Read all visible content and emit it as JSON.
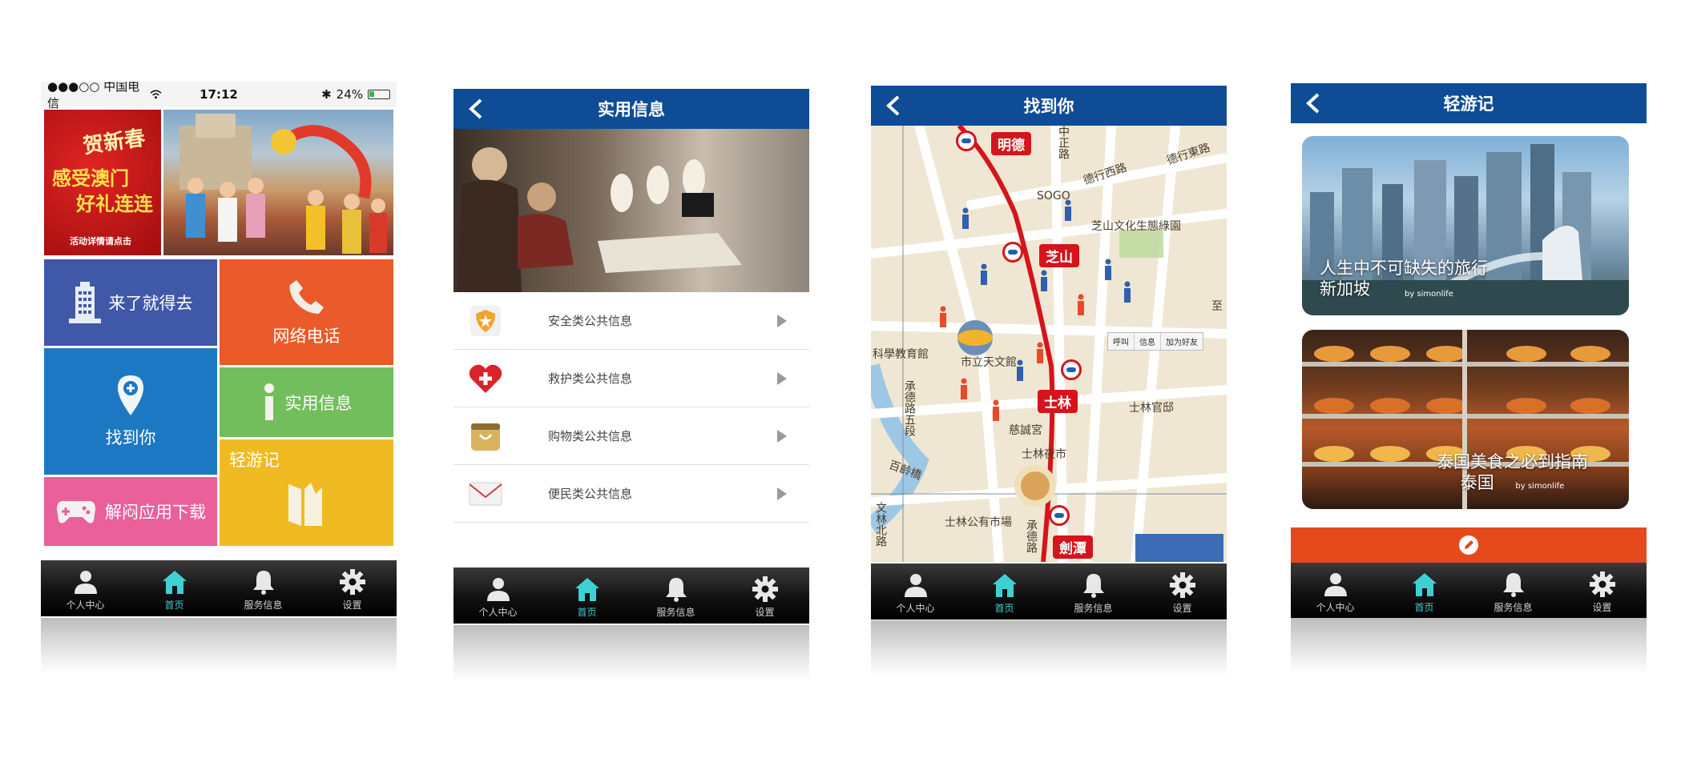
{
  "tabbar": {
    "items": [
      {
        "label": "个人中心",
        "icon": "person-icon"
      },
      {
        "label": "首页",
        "icon": "home-icon"
      },
      {
        "label": "服务信息",
        "icon": "bell-icon"
      },
      {
        "label": "设置",
        "icon": "gear-icon"
      }
    ],
    "active_index": 1,
    "active_color": "#3fd0d4"
  },
  "screen1": {
    "status": {
      "carrier": "●●●○○ 中国电信",
      "time": "17:12",
      "battery": "24%"
    },
    "banner": {
      "promo_line1": "贺新春",
      "promo_line2": "感受澳门",
      "promo_line3": "好礼连连",
      "promo_note": "活动详情请点击"
    },
    "tiles": [
      {
        "label": "来了就得去",
        "icon": "building-icon",
        "color": "#3f58a8"
      },
      {
        "label": "网络电话",
        "icon": "phone-icon",
        "color": "#ea5a2b"
      },
      {
        "label": "找到你",
        "icon": "location-pin-icon",
        "color": "#1d78c3"
      },
      {
        "label": "实用信息",
        "icon": "info-icon",
        "color": "#72be5c"
      },
      {
        "label": "轻游记",
        "icon": "book-icon",
        "color": "#f0bb22"
      },
      {
        "label": "解闷应用下载",
        "icon": "gamepad-icon",
        "color": "#e9609a"
      }
    ]
  },
  "screen2": {
    "title": "实用信息",
    "items": [
      {
        "label": "安全类公共信息",
        "icon": "shield-icon"
      },
      {
        "label": "救护类公共信息",
        "icon": "medical-heart-icon"
      },
      {
        "label": "购物类公共信息",
        "icon": "shopping-bag-icon"
      },
      {
        "label": "便民类公共信息",
        "icon": "envelope-icon"
      }
    ]
  },
  "screen3": {
    "title": "找到你",
    "stations": [
      "明德",
      "芝山",
      "士林",
      "劍潭"
    ],
    "places": [
      "SOGO",
      "德行西路",
      "德行東路",
      "芝山文化生態綠園",
      "科學教育館",
      "市立天文館",
      "士林官邸",
      "慈誠宮",
      "士林夜市",
      "士林公有市場",
      "百齡橋",
      "承德路五段",
      "承德路",
      "中正路",
      "文林北路",
      "至"
    ],
    "popup": [
      "呼叫",
      "信息",
      "加为好友"
    ]
  },
  "screen4": {
    "title": "轻游记",
    "cards": [
      {
        "caption_line1": "人生中不可缺失的旅行",
        "caption_line2": "新加坡",
        "credit": "by simonlife"
      },
      {
        "caption_line1": "泰国美食之必到指南",
        "caption_line2": "泰国",
        "credit": "by simonlife"
      }
    ],
    "action_bar_color": "#e44a1c",
    "action_icon": "pencil-icon"
  }
}
